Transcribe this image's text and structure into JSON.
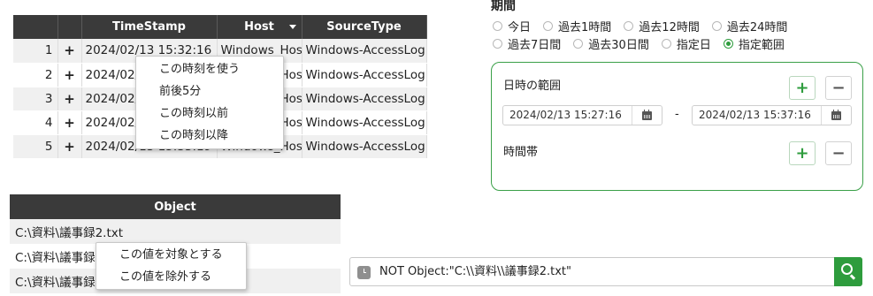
{
  "log_table": {
    "columns": [
      "",
      "",
      "TimeStamp",
      "Host",
      "SourceType"
    ],
    "rows": [
      {
        "num": "1",
        "plus": "+",
        "timestamp": "2024/02/13 15:32:16",
        "host": "Windows_Host",
        "sourcetype": "Windows-AccessLog"
      },
      {
        "num": "2",
        "plus": "+",
        "timestamp": "2024/02/13 15:32:16",
        "host": "Windows_Host",
        "sourcetype": "Windows-AccessLog"
      },
      {
        "num": "3",
        "plus": "+",
        "timestamp": "2024/02/13 15:32:16",
        "host": "Windows_Host",
        "sourcetype": "Windows-AccessLog"
      },
      {
        "num": "4",
        "plus": "+",
        "timestamp": "2024/02/13 15:32:16",
        "host": "Windows_Host",
        "sourcetype": "Windows-AccessLog"
      },
      {
        "num": "5",
        "plus": "+",
        "timestamp": "2024/02/13 15:33:19",
        "host": "Windows_Host",
        "sourcetype": "Windows-AccessLog"
      }
    ]
  },
  "time_context_menu": {
    "items": [
      "この時刻を使う",
      "前後5分",
      "この時刻以前",
      "この時刻以降"
    ]
  },
  "object_table": {
    "header": "Object",
    "rows": [
      "C:\\資料\\議事録2.txt",
      "C:\\資料\\議事録2.txt",
      "C:\\資料\\議事録2.txt"
    ]
  },
  "value_context_menu": {
    "items": [
      "この値を対象とする",
      "この値を除外する"
    ]
  },
  "period": {
    "title": "期間",
    "options_row1": [
      {
        "label": "今日",
        "checked": false
      },
      {
        "label": "過去1時間",
        "checked": false
      },
      {
        "label": "過去12時間",
        "checked": false
      },
      {
        "label": "過去24時間",
        "checked": false
      }
    ],
    "options_row2": [
      {
        "label": "過去7日間",
        "checked": false
      },
      {
        "label": "過去30日間",
        "checked": false
      },
      {
        "label": "指定日",
        "checked": false
      },
      {
        "label": "指定範囲",
        "checked": true
      }
    ]
  },
  "range_panel": {
    "datetime_label": "日時の範囲",
    "start": "2024/02/13 15:27:16",
    "separator": "-",
    "end": "2024/02/13 15:37:16",
    "timeband_label": "時間帯",
    "add": "+",
    "remove": "−"
  },
  "search": {
    "query": "NOT Object:\"C:\\\\資料\\\\議事録2.txt\""
  },
  "colors": {
    "accent_green": "#2e9c3d",
    "header_dark": "#3a3a3a"
  },
  "icons": [
    "history-icon",
    "calendar-icon",
    "search-icon",
    "sort-caret-icon"
  ]
}
